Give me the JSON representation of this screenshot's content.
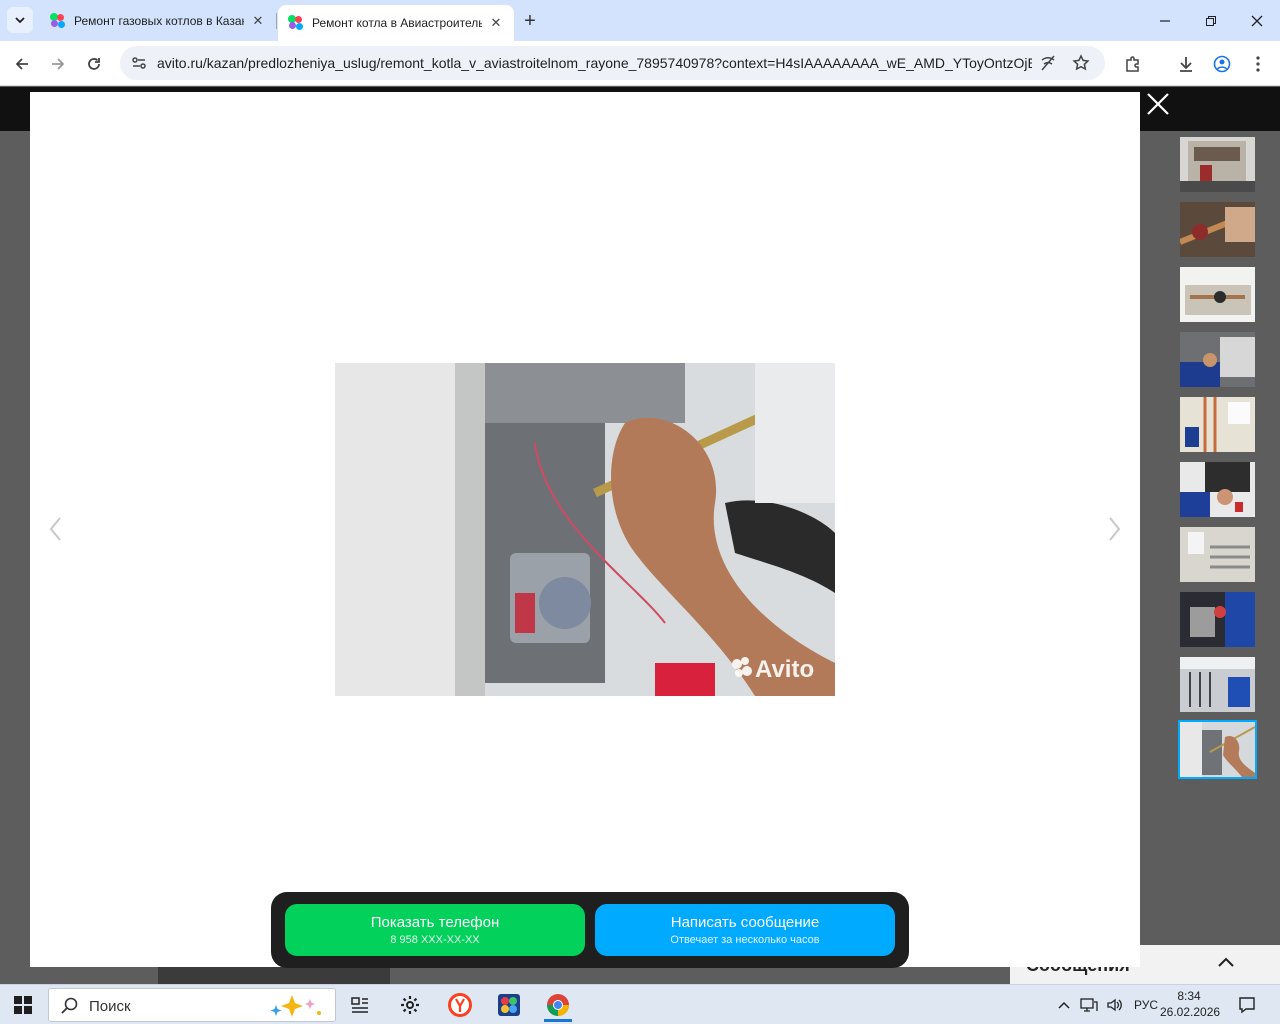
{
  "browser": {
    "tabs": [
      {
        "title": "Ремонт газовых котлов в Казани",
        "active": false
      },
      {
        "title": "Ремонт котла в Авиастроительном районе",
        "active": true
      }
    ],
    "url": "avito.ru/kazan/predlozheniya_uslug/remont_kotla_v_aviastroitelnom_rayone_7895740978?context=H4sIAAAAAAAA_wE_AMD_YToyOntzOjEz...",
    "colors": {
      "tabstrip": "#d3e3fd",
      "toolbar": "#ffffff"
    }
  },
  "page_behind": {
    "messages_label": "Сообщения"
  },
  "viewer": {
    "watermark": "Avito",
    "thumbnail_count": 10,
    "active_thumbnail_index": 9
  },
  "cta": {
    "phone_label": "Показать телефон",
    "phone_number": "8 958 XXX-XX-XX",
    "message_label": "Написать сообщение",
    "message_sub": "Отвечает за несколько часов",
    "colors": {
      "phone": "#02d15c",
      "message": "#00aaff"
    }
  },
  "taskbar": {
    "search_placeholder": "Поиск",
    "language": "РУС",
    "time": "8:34",
    "date": "26.02.2026"
  }
}
